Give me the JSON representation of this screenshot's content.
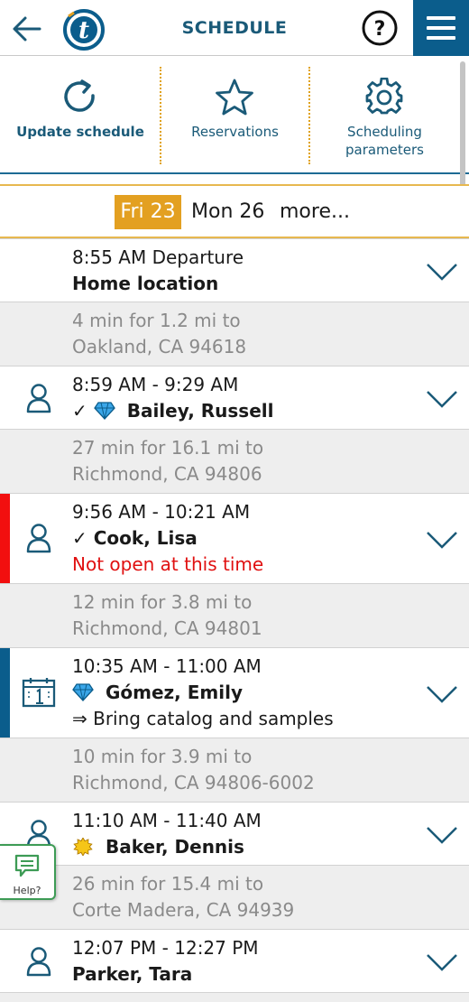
{
  "header": {
    "title": "SCHEDULE",
    "help_symbol": "?",
    "back_icon": "back-arrow-icon",
    "logo_letter": "t",
    "menu_icon": "hamburger-menu-icon"
  },
  "toolbar": {
    "update_label": "Update schedule",
    "reservations_label": "Reservations",
    "params_label_1": "Scheduling",
    "params_label_2": "parameters"
  },
  "days": {
    "selected": "Fri 23",
    "next": "Mon 26",
    "more": "more..."
  },
  "schedule": [
    {
      "time": "8:55 AM Departure",
      "name": "Home location"
    },
    {
      "gap_1": "4 min for 1.2 mi to",
      "gap_2": "Oakland, CA 94618"
    },
    {
      "time": "8:59 AM - 9:29 AM",
      "check": "✓",
      "name": "Bailey, Russell"
    },
    {
      "gap_1": "27 min for 16.1 mi to",
      "gap_2": "Richmond, CA 94806"
    },
    {
      "time": "9:56 AM - 10:21 AM",
      "check": "✓",
      "name": "Cook, Lisa",
      "warning": "Not open at this time"
    },
    {
      "gap_1": "12 min for 3.8 mi to",
      "gap_2": "Richmond, CA 94801"
    },
    {
      "time": "10:35 AM - 11:00 AM",
      "name": "Gómez, Emily",
      "note": "⇒ Bring catalog and samples"
    },
    {
      "gap_1": "10 min for 3.9 mi to",
      "gap_2": "Richmond, CA 94806-6002"
    },
    {
      "time": "11:10 AM - 11:40 AM",
      "name": "Baker, Dennis"
    },
    {
      "gap_1": "26 min for 15.4 mi to",
      "gap_2": "Corte Madera, CA 94939"
    },
    {
      "time": "12:07 PM - 12:27 PM",
      "name": "Parker, Tara"
    }
  ],
  "help_float": {
    "label": "Help?"
  },
  "colors": {
    "brand": "#0b5d8c",
    "accent": "#e3a021",
    "warning": "#e01010",
    "stripe_blue": "#0b5d8c",
    "help_green": "#3d9b55"
  }
}
